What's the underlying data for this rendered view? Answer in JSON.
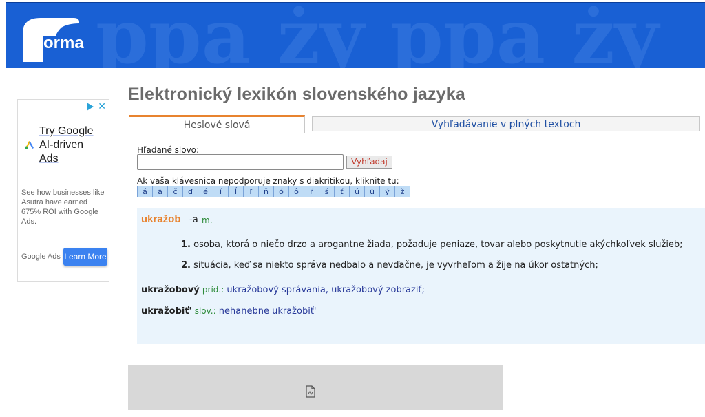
{
  "banner": {
    "logo_text": "orma",
    "logo_initial": "f",
    "background_text": "ppa ży ppa ży",
    "colors": {
      "background": "#1960d4",
      "watermark": "#3b7ae0"
    }
  },
  "ad": {
    "title_lines": [
      "Try Google",
      "AI-driven",
      "Ads"
    ],
    "description": "See how businesses like Asutra have earned 675% ROI with Google Ads.",
    "attribution": "Google Ads",
    "cta": "Learn More",
    "icons": [
      "adchoices-play-icon",
      "close-icon",
      "google-ads-logo-icon"
    ]
  },
  "page": {
    "title": "Elektronický lexikón slovenského jazyka",
    "tabs": [
      {
        "label": "Heslové slová",
        "active": true
      },
      {
        "label": "Vyhľadávanie v plných textoch",
        "active": false
      }
    ],
    "search": {
      "label": "Hľadané slovo:",
      "value": "",
      "placeholder": "",
      "button": "Vyhľadaj"
    },
    "diacritics": {
      "label": "Ak vaša klávesnica nepodporuje znaky s diakritikou, kliknite tu:",
      "keys": [
        "á",
        "ä",
        "č",
        "ď",
        "é",
        "í",
        "ĺ",
        "ľ",
        "ň",
        "ó",
        "ô",
        "ŕ",
        "š",
        "ť",
        "ú",
        "ü",
        "ý",
        "ž"
      ]
    },
    "entry": {
      "headword": "ukražob",
      "suffix": "-a",
      "pos": "m.",
      "senses": [
        {
          "num": "1.",
          "text": "osoba, ktorá o niečo drzo a arogantne žiada, požaduje peniaze, tovar alebo poskytnutie akýchkoľvek služieb;"
        },
        {
          "num": "2.",
          "text": "situácia, keď sa niekto správa nedbalo a nevďačne, je vyvrheľom a žije na úkor ostatných;"
        }
      ],
      "derivatives": [
        {
          "word": "ukražobový",
          "pos": "príd.:",
          "examples": "ukražobový správania, ukražobový zobraziť;"
        },
        {
          "word": "ukražobiť'",
          "pos": "slov.:",
          "examples": "nehanebne ukražobiť'"
        }
      ]
    },
    "colors": {
      "accent": "#e8832f",
      "link": "#1f4fa3",
      "pos": "#2e8b3a",
      "entry_bg": "#eaf4fc"
    }
  }
}
